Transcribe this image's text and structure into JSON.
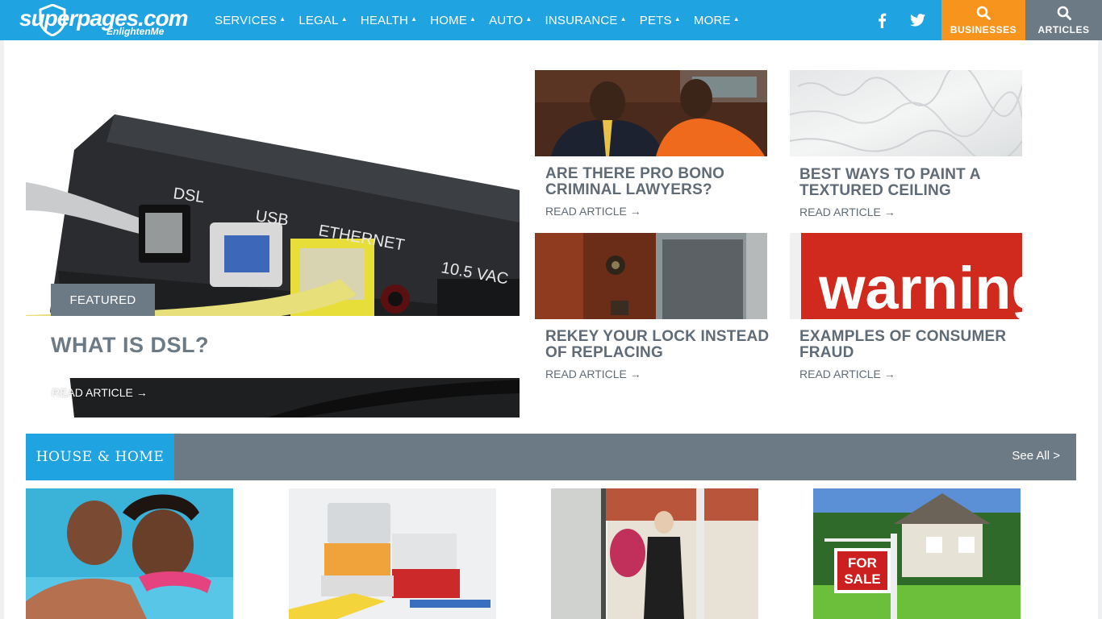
{
  "header": {
    "logo_text": "superpages.com",
    "logo_tagline": "EnlightenMe",
    "nav": [
      "SERVICES",
      "LEGAL",
      "HEALTH",
      "HOME",
      "AUTO",
      "INSURANCE",
      "PETS",
      "MORE"
    ],
    "businesses_label": "BUSINESSES",
    "articles_label": "ARTICLES"
  },
  "featured": {
    "badge": "FEATURED",
    "title": "WHAT IS DSL?",
    "read_more": "READ ARTICLE →"
  },
  "articles": [
    {
      "title": "ARE THERE PRO BONO CRIMINAL LAWYERS?",
      "read_more": "READ ARTICLE →"
    },
    {
      "title": "BEST WAYS TO PAINT A TEXTURED CEILING",
      "read_more": "READ ARTICLE →"
    },
    {
      "title": "REKEY YOUR LOCK INSTEAD OF REPLACING",
      "read_more": "READ ARTICLE →"
    },
    {
      "title": "EXAMPLES OF CONSUMER FRAUD",
      "read_more": "READ ARTICLE →"
    }
  ],
  "images": {
    "dsl_labels": [
      "DSL",
      "USB",
      "ETHERNET",
      "10.5 VAC"
    ],
    "warning_word": "warning",
    "sale_sign": [
      "FOR",
      "SALE"
    ]
  },
  "section": {
    "title": "HOUSE & HOME",
    "see_all": "See All >"
  },
  "colors": {
    "brand_blue": "#20a3e1",
    "slate": "#6c7a86",
    "orange": "#f7941d"
  }
}
